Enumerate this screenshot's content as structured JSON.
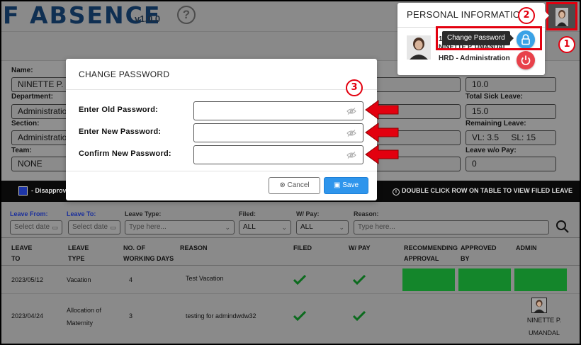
{
  "app": {
    "title": "F ABSENCE",
    "version": "v1.0.0",
    "help": "?"
  },
  "profile": {
    "title": "PERSONAL INFORMATION",
    "id_partial": "12",
    "name": "NINETTE P. UMANDAL",
    "department": "HRD - Administration",
    "tooltip": "Change Password"
  },
  "employee_form": {
    "name_label": "Name:",
    "name_value": "NINETTE P. U",
    "department_label": "Department:",
    "department_value": "Administration",
    "section_label": "Section:",
    "section_value": "Administration",
    "team_label": "Team:",
    "team_value": "NONE",
    "vl_value": "10.0",
    "total_sick_label": "Total Sick Leave:",
    "total_sick_value": "15.0",
    "remaining_label": "Remaining Leave:",
    "remaining_vl": "VL: 3.5",
    "remaining_sl": "SL: 15",
    "leave_wo_pay_label": "Leave w/o Pay:",
    "leave_wo_pay_value": "0"
  },
  "legend": {
    "text": "- Disapprov",
    "hint": "DOUBLE CLICK ROW ON TABLE TO VIEW FILED LEAVE"
  },
  "filters": {
    "leave_from": "Leave From:",
    "leave_to": "Leave To:",
    "leave_type": "Leave Type:",
    "filed": "Filed:",
    "w_pay": "W/ Pay:",
    "reason": "Reason:",
    "date_placeholder": "Select date",
    "type_placeholder": "Type here...",
    "filed_value": "ALL",
    "w_pay_value": "ALL",
    "reason_placeholder": "Type here..."
  },
  "table": {
    "headers": [
      "LEAVE TO",
      "LEAVE TYPE",
      "NO. OF WORKING DAYS",
      "REASON",
      "FILED",
      "W/ PAY",
      "RECOMMENDING APPROVAL",
      "APPROVED BY",
      "ADMIN"
    ],
    "header_lines": {
      "leave_to": [
        "LEAVE",
        "TO"
      ],
      "leave_type": [
        "LEAVE",
        "TYPE"
      ],
      "days": [
        "NO. OF",
        "WORKING DAYS"
      ],
      "reason": [
        "REASON"
      ],
      "filed": [
        "FILED"
      ],
      "w_pay": [
        "W/ PAY"
      ],
      "recommending": [
        "RECOMMENDING",
        "APPROVAL"
      ],
      "approved": [
        "APPROVED",
        "BY"
      ],
      "admin": [
        "ADMIN"
      ]
    },
    "rows": [
      {
        "leave_to": "2023/05/12",
        "type": "Vacation",
        "days": "4",
        "reason": "Test Vacation"
      },
      {
        "leave_to": "2023/04/24",
        "type_line1": "Allocation of",
        "type_line2": "Maternity",
        "days": "3",
        "reason": "testing for admindwdw32",
        "admin_line1": "NINETTE P.",
        "admin_line2": "UMANDAL"
      }
    ]
  },
  "modal": {
    "title": "CHANGE PASSWORD",
    "old_label": "Enter Old Password:",
    "new_label": "Enter New Password:",
    "confirm_label": "Confirm New Password:",
    "cancel_label": "Cancel",
    "save_label": "Save"
  },
  "annotations": {
    "n1": "1",
    "n2": "2",
    "n3": "3"
  },
  "colors": {
    "highlight": "#e3000f",
    "primary": "#2e95ec",
    "danger": "#e8414a",
    "approved": "#14862b",
    "legend_swatch": "#1e36a8"
  }
}
